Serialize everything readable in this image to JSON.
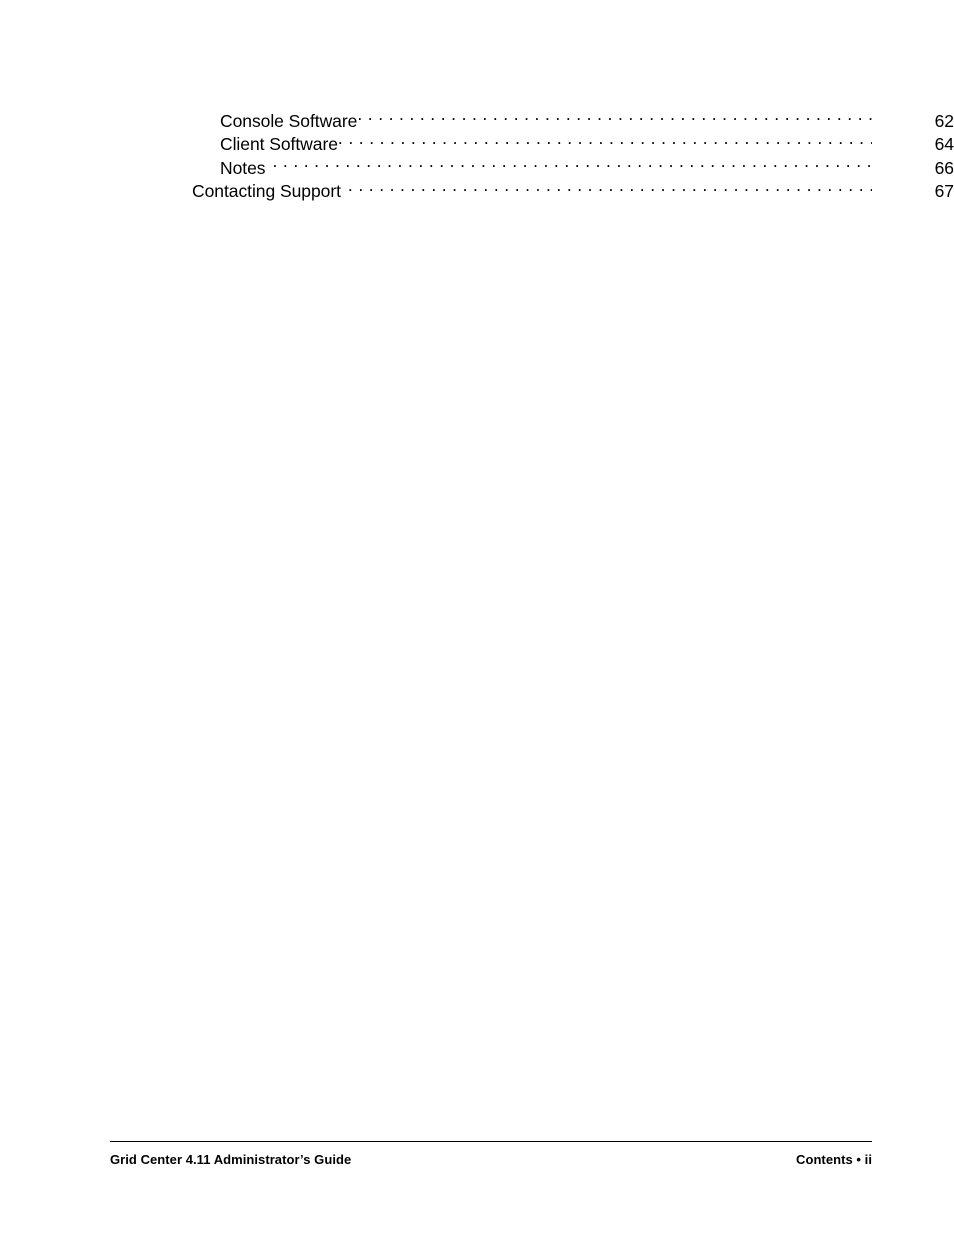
{
  "document": {
    "type": "table-of-contents-continuation",
    "page_label": "ii"
  },
  "toc": {
    "entries": [
      {
        "title": "Console Software",
        "page": "62",
        "level": 2,
        "leader_style": "tight"
      },
      {
        "title": "Client Software",
        "page": "64",
        "level": 2,
        "leader_style": "tight"
      },
      {
        "title": "Notes",
        "page": "66",
        "level": 2,
        "leader_style": "spaced"
      },
      {
        "title": "Contacting Support",
        "page": "67",
        "level": 1,
        "leader_style": "spaced"
      }
    ]
  },
  "footer": {
    "left": "Grid Center 4.11 Administrator’s Guide",
    "right": "Contents • ii"
  },
  "colors": {
    "text": "#000000",
    "background": "#ffffff",
    "rule": "#000000"
  }
}
